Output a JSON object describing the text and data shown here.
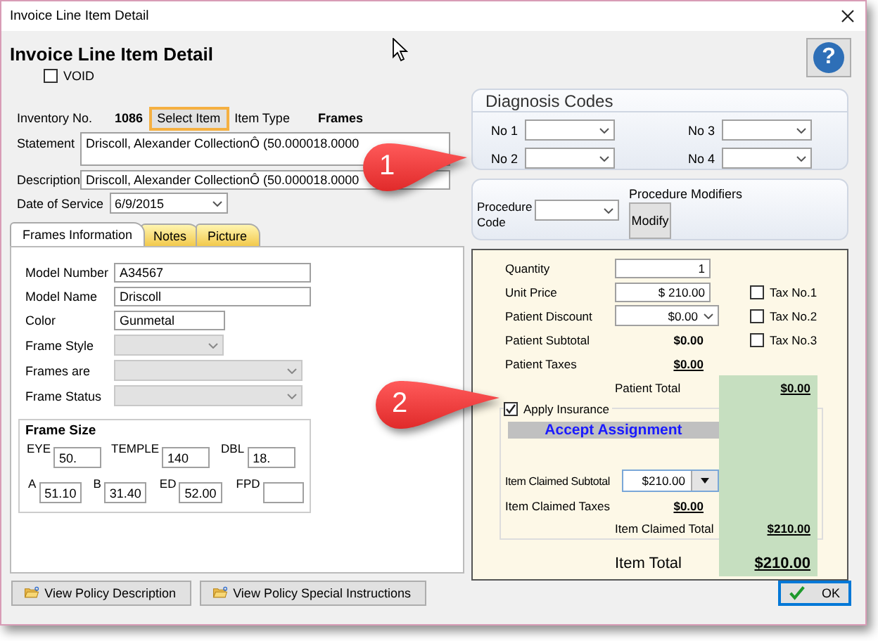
{
  "window": {
    "title": "Invoice Line Item Detail"
  },
  "heading": "Invoice Line Item Detail",
  "void": {
    "label": "VOID",
    "checked": false
  },
  "help_button": "?",
  "item": {
    "inventory_label": "Inventory No.",
    "inventory_no": "1086",
    "select_button": "Select Item",
    "type_label": "Item Type",
    "type": "Frames"
  },
  "statement": {
    "label": "Statement",
    "value": "Driscoll, Alexander CollectionÔ (50.000018.0000"
  },
  "description": {
    "label": "Description",
    "value": "Driscoll, Alexander CollectionÔ (50.000018.0000"
  },
  "date_of_service": {
    "label": "Date of Service",
    "value": "6/9/2015"
  },
  "tabs": [
    {
      "label": "Frames Information",
      "selected": true
    },
    {
      "label": "Notes",
      "selected": false
    },
    {
      "label": "Picture",
      "selected": false
    }
  ],
  "frame_fields": [
    {
      "label": "Model Number",
      "kind": "text",
      "value": "A34567"
    },
    {
      "label": "Model Name",
      "kind": "text",
      "value": "Driscoll"
    },
    {
      "label": "Color",
      "kind": "text",
      "value": "Gunmetal"
    },
    {
      "label": "Frame Style",
      "kind": "combo",
      "disabled": true
    },
    {
      "label": "Frames are",
      "kind": "combo",
      "disabled": true
    },
    {
      "label": "Frame Status",
      "kind": "combo",
      "disabled": true
    }
  ],
  "frame_size": {
    "title": "Frame Size",
    "fields": [
      {
        "label": "EYE",
        "value": "50."
      },
      {
        "label": "TEMPLE",
        "value": "140"
      },
      {
        "label": "DBL",
        "value": "18."
      },
      {
        "label": "A",
        "value": "51.10"
      },
      {
        "label": "B",
        "value": "31.40"
      },
      {
        "label": "ED",
        "value": "52.00"
      },
      {
        "label": "FPD"
      }
    ]
  },
  "diagnosis": {
    "title": "Diagnosis Codes",
    "codes": [
      {
        "label": "No 1"
      },
      {
        "label": "No 2"
      },
      {
        "label": "No 3"
      },
      {
        "label": "No 4"
      }
    ]
  },
  "procedure": {
    "code_label": "Procedure Code",
    "modifiers_label": "Procedure Modifiers",
    "modify_button": "Modify"
  },
  "billing": {
    "quantity": {
      "label": "Quantity",
      "value": "1"
    },
    "unit_price": {
      "label": "Unit Price",
      "value": "$ 210.00"
    },
    "patient_discount": {
      "label": "Patient Discount",
      "value": "$0.00"
    },
    "patient_subtotal": {
      "label": "Patient Subtotal",
      "value": "$0.00"
    },
    "patient_taxes": {
      "label": "Patient Taxes",
      "value": "$0.00"
    },
    "patient_total": {
      "label": "Patient Total",
      "value": "$0.00"
    },
    "taxes": [
      {
        "label": "Tax No.1",
        "checked": false
      },
      {
        "label": "Tax No.2",
        "checked": false
      },
      {
        "label": "Tax No.3",
        "checked": false
      }
    ],
    "apply_insurance": {
      "label": "Apply Insurance",
      "checked": true
    },
    "accept_assignment": "Accept Assignment",
    "claimed_subtotal": {
      "label": "Item Claimed Subtotal",
      "value": "$210.00"
    },
    "claimed_taxes": {
      "label": "Item Claimed Taxes",
      "value": "$0.00"
    },
    "claimed_total": {
      "label": "Item Claimed Total",
      "value": "$210.00"
    },
    "item_total": {
      "label": "Item Total",
      "value": "$210.00"
    }
  },
  "footer_buttons": [
    {
      "label": "View Policy Description"
    },
    {
      "label": "View Policy Special Instructions"
    }
  ],
  "ok_button": "OK",
  "callouts": [
    "1",
    "2"
  ]
}
